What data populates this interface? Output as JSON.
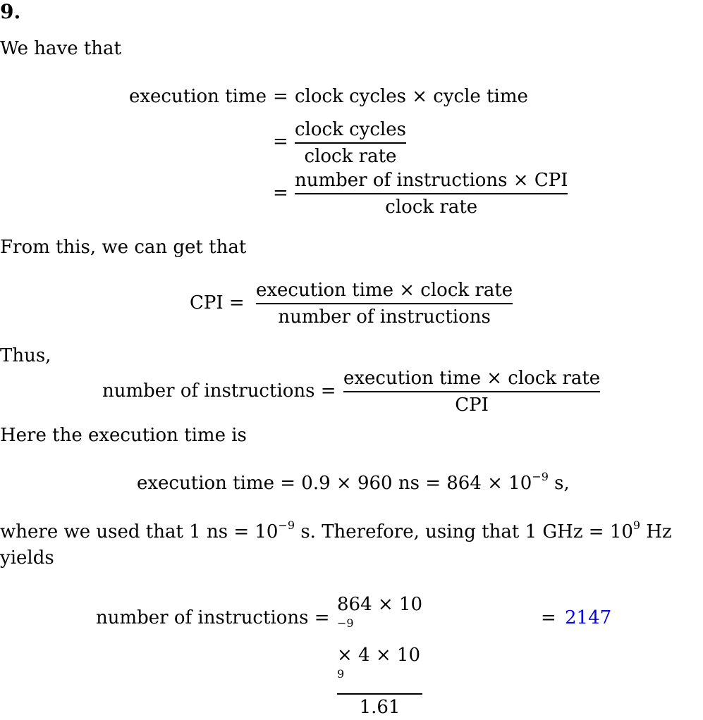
{
  "heading": "9.",
  "intro": "We have that",
  "eq1": {
    "lhs": "execution time",
    "rhs1": "clock cycles × cycle time",
    "frac2_num": "clock cycles",
    "frac2_den": "clock rate",
    "frac3_num": "number of instructions × CPI",
    "frac3_den": "clock rate"
  },
  "from_this": "From this, we can get that",
  "eq2": {
    "lhs": "CPI =",
    "num": "execution time × clock rate",
    "den": "number of instructions"
  },
  "thus": "Thus,",
  "eq3": {
    "lhs": "number of instructions =",
    "num": "execution time × clock rate",
    "den": "CPI"
  },
  "here": "Here the execution time is",
  "eq4": {
    "a": "execution time = 0.9 × 960 ns = 864 × 10",
    "a_exp": "−9",
    "b": " s,"
  },
  "where": {
    "p1": "where we used that 1 ns = 10",
    "p1_exp": "−9",
    "p2": " s.  Therefore, using that 1 GHz = 10",
    "p2_exp": "9",
    "p3": " Hz",
    "line2": "yields"
  },
  "eq5": {
    "lhs": "number of instructions =",
    "num_a": "864 × 10",
    "num_a_exp": "−9",
    "num_b": " × 4 × 10",
    "num_b_exp": "9",
    "den": "1.61",
    "eq": "=",
    "result": "2147"
  }
}
